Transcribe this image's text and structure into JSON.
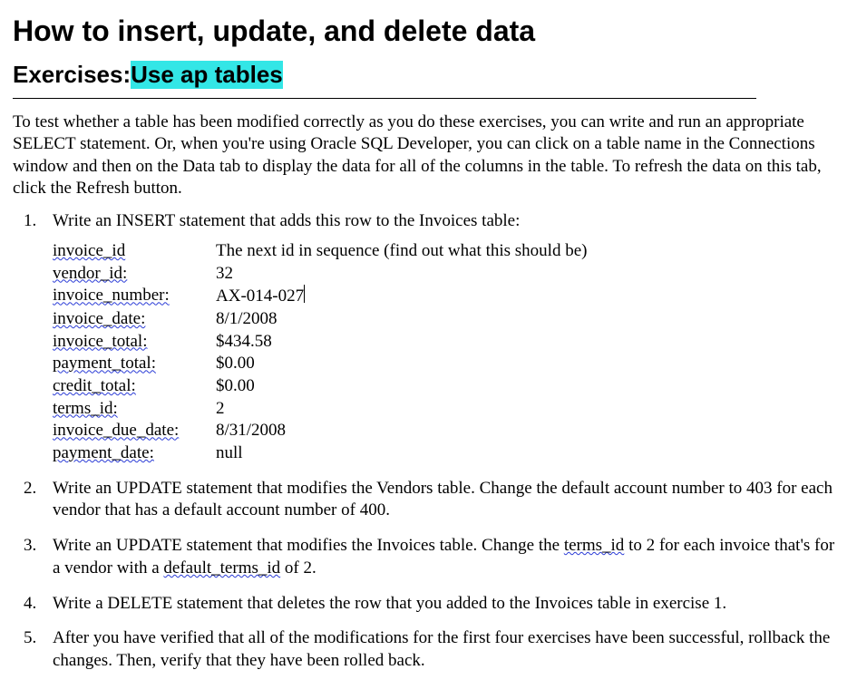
{
  "title": "How to insert, update, and delete data",
  "subtitle_prefix": "Exercises: ",
  "subtitle_highlight": "Use ap tables",
  "intro": "To test whether a table has been modified correctly as you do these exercises, you can write and run an appropriate SELECT statement. Or, when you're using Oracle SQL Developer, you can click on a table name in the Connections window and then on the Data tab to display the data for all of the columns in the table. To refresh the data on this tab, click the Refresh button.",
  "exercises": {
    "e1": {
      "text": "Write an INSERT statement that adds this row to the Invoices table:",
      "fields": [
        {
          "name": "invoice_id",
          "value": "The next id in sequence (find out what this should be)"
        },
        {
          "name": "vendor_id:",
          "value": "32"
        },
        {
          "name": "invoice_number:",
          "value": "AX-014-027"
        },
        {
          "name": "invoice_date:",
          "value": "8/1/2008"
        },
        {
          "name": "invoice_total:",
          "value": "$434.58"
        },
        {
          "name": "payment_total:",
          "value": "$0.00"
        },
        {
          "name": "credit_total:",
          "value": "$0.00"
        },
        {
          "name": "terms_id:",
          "value": "2"
        },
        {
          "name": "invoice_due_date:",
          "value": "8/31/2008"
        },
        {
          "name": "payment_date:",
          "value": "null"
        }
      ]
    },
    "e2": "Write an UPDATE statement that modifies the Vendors table. Change the default account number to 403 for each vendor that has a default account number of 400.",
    "e3a": "Write an UPDATE statement that modifies the Invoices table. Change the ",
    "e3b": "terms_id",
    "e3c": " to 2 for each invoice that's for a vendor with a ",
    "e3d": "default_terms_id",
    "e3e": " of 2.",
    "e4": "Write a DELETE statement that deletes the row that you added to the Invoices table in exercise 1.",
    "e5": "After you have verified that all of the modifications for the first four exercises have been successful, rollback the changes. Then, verify that they have been rolled back."
  }
}
